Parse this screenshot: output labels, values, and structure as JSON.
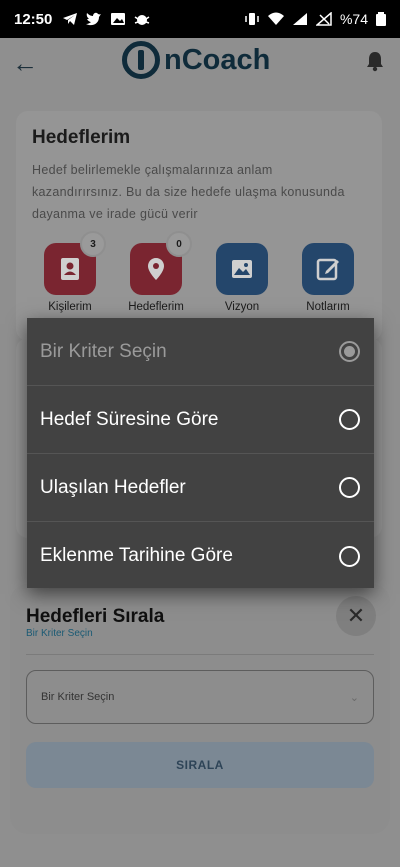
{
  "status": {
    "time": "12:50",
    "battery": "%74"
  },
  "header": {
    "app_name": "nCoach"
  },
  "goals_card": {
    "title": "Hedeflerim",
    "description": "Hedef belirlemekle çalışmalarınıza anlam kazandırırsınız. Bu da size hedefe ulaşma konusunda dayanma ve irade gücü verir",
    "items": [
      {
        "label": "Kişilerim",
        "badge": "3",
        "color": "red"
      },
      {
        "label": "Hedeflerim",
        "badge": "0",
        "color": "red"
      },
      {
        "label": "Vizyon",
        "badge": "",
        "color": "blue"
      },
      {
        "label": "Notlarım",
        "badge": "",
        "color": "blue"
      }
    ]
  },
  "dropdown": {
    "options": [
      {
        "label": "Bir Kriter Seçin",
        "selected": true,
        "disabled": true
      },
      {
        "label": "Hedef Süresine Göre",
        "selected": false
      },
      {
        "label": "Ulaşılan Hedefler",
        "selected": false
      },
      {
        "label": "Eklenme Tarihine Göre",
        "selected": false
      }
    ]
  },
  "sheet": {
    "title": "Hedefleri Sırala",
    "subtitle": "Bir Kriter Seçin",
    "select_value": "Bir Kriter Seçin",
    "sort_button": "SIRALA"
  }
}
